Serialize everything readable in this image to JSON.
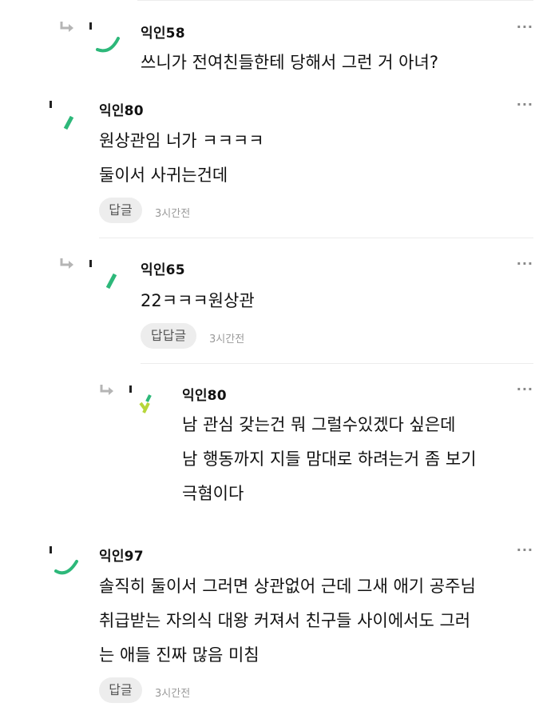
{
  "comments": [
    {
      "nickname": "익인58",
      "lines": [
        "쓰니가 전여친들한테 당해서 그런 거 아녀?"
      ],
      "more": "···"
    },
    {
      "nickname": "익인80",
      "lines": [
        "원상관임 너가 ㅋㅋㅋㅋ",
        "둘이서 사귀는건데"
      ],
      "reply_label": "답글",
      "time": "3시간전",
      "more": "···"
    },
    {
      "nickname": "익인65",
      "lines": [
        "22ㅋㅋㅋ원상관"
      ],
      "reply_label": "답답글",
      "time": "3시간전",
      "more": "···"
    },
    {
      "nickname": "익인80",
      "lines": [
        "남 관심 갖는건 뭐 그럴수있겠다 싶은데",
        "남 행동까지 지들 맘대로 하려는거 좀 보기",
        "극혐이다"
      ],
      "more": "···"
    },
    {
      "nickname": "익인97",
      "lines": [
        "솔직히 둘이서 그러면 상관없어 근데 그새 애기 공주님",
        "취급받는 자의식 대왕 커져서 친구들 사이에서도 그러",
        "는 애들 진짜 많음 미침"
      ],
      "reply_label": "답글",
      "time": "3시간전",
      "more": "···"
    }
  ],
  "colors": {
    "accent_green": "#2db87a",
    "accent_lime": "#b6d63a",
    "reply_bg": "#ededed"
  },
  "icons": [
    "reply-arrow-icon",
    "avatar-icon",
    "more-dots-icon"
  ]
}
